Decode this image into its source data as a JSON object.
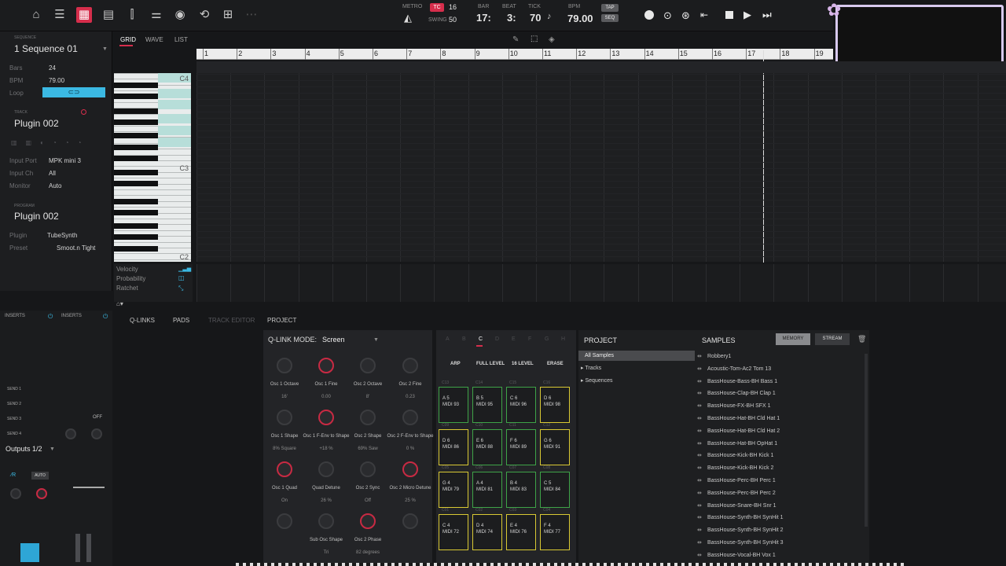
{
  "transport": {
    "metro": "METRO",
    "tc": "TC",
    "tc_val": "16",
    "swing_label": "SWING",
    "swing_val": "50",
    "bar_label": "BAR",
    "bar": "17:",
    "beat_label": "BEAT",
    "beat": "3:",
    "tick_label": "TICK",
    "tick": "70",
    "bpm_label": "BPM",
    "bpm": "79.00",
    "tap": "TAP",
    "seq": "SEQ"
  },
  "sequence": {
    "section": "SEQUENCE",
    "name": "1 Sequence 01",
    "bars_label": "Bars",
    "bars": "24",
    "bpm_label": "BPM",
    "bpm": "79.00",
    "loop_label": "Loop"
  },
  "track": {
    "section": "TRACK",
    "name": "Plugin 002",
    "input_port_label": "Input Port",
    "input_port": "MPK mini 3",
    "input_ch_label": "Input Ch",
    "input_ch": "All",
    "monitor_label": "Monitor",
    "monitor": "Auto"
  },
  "program": {
    "section": "PROGRAM",
    "name": "Plugin 002",
    "plugin_label": "Plugin",
    "plugin": "TubeSynth",
    "preset_label": "Preset",
    "preset": "Smoot.n Tight"
  },
  "view_tabs": [
    "GRID",
    "WAVE",
    "LIST"
  ],
  "ruler": [
    "1",
    "2",
    "3",
    "4",
    "5",
    "6",
    "7",
    "8",
    "9",
    "10",
    "11",
    "12",
    "13",
    "14",
    "15",
    "16",
    "17",
    "18",
    "19"
  ],
  "keys": {
    "c4": "C4",
    "c3": "C3",
    "c2": "C2"
  },
  "lanes": [
    "Velocity",
    "Probability",
    "Ratchet"
  ],
  "mixer": {
    "inserts1": "INSERTS",
    "inserts2": "INSERTS",
    "sends": [
      "SEND 1",
      "SEND 2",
      "SEND 3",
      "SEND 4"
    ],
    "off": "OFF",
    "auto": "AUTO",
    "outputs": "Outputs 1/2"
  },
  "bottom_tabs": {
    "qlinks": "Q-LINKS",
    "pads": "PADS",
    "track_editor": "TRACK EDITOR",
    "project": "PROJECT"
  },
  "qlink": {
    "mode_label": "Q-LINK MODE:",
    "mode": "Screen",
    "knobs": [
      {
        "name": "Osc 1 Octave",
        "value": "16'"
      },
      {
        "name": "Osc 1 Fine",
        "value": "0.00"
      },
      {
        "name": "Osc 2 Octave",
        "value": "8'"
      },
      {
        "name": "Osc 2 Fine",
        "value": "0.23"
      },
      {
        "name": "Osc 1 Shape",
        "value": "8% Square"
      },
      {
        "name": "Osc 1 F-Env to Shape",
        "value": "+18 %"
      },
      {
        "name": "Osc 2 Shape",
        "value": "69% Saw"
      },
      {
        "name": "Osc 2 F-Env to Shape",
        "value": "0 %"
      },
      {
        "name": "Osc 1 Quad",
        "value": "On"
      },
      {
        "name": "Quad Detune",
        "value": "26 %"
      },
      {
        "name": "Osc 2 Sync",
        "value": "Off"
      },
      {
        "name": "Osc 2 Micro Detune",
        "value": "25 %"
      },
      {
        "name": "",
        "value": ""
      },
      {
        "name": "Sub Osc Shape",
        "value": "Tri"
      },
      {
        "name": "Osc 2 Phase",
        "value": "82 degrees"
      },
      {
        "name": "",
        "value": ""
      }
    ]
  },
  "pads": {
    "banks": [
      "A",
      "B",
      "C",
      "D",
      "E",
      "F",
      "G",
      "H"
    ],
    "heads": [
      "ARP",
      "FULL LEVEL",
      "16 LEVEL",
      "ERASE"
    ],
    "grid": [
      {
        "num": "C13",
        "note": "A 5",
        "midi": "MIDI 93"
      },
      {
        "num": "C14",
        "note": "B 5",
        "midi": "MIDI 95"
      },
      {
        "num": "C15",
        "note": "C 6",
        "midi": "MIDI 96"
      },
      {
        "num": "C16",
        "note": "D 6",
        "midi": "MIDI 98"
      },
      {
        "num": "C09",
        "note": "D 6",
        "midi": "MIDI 86"
      },
      {
        "num": "C10",
        "note": "E 6",
        "midi": "MIDI 88"
      },
      {
        "num": "C11",
        "note": "F 6",
        "midi": "MIDI 89"
      },
      {
        "num": "C12",
        "note": "G 6",
        "midi": "MIDI 91"
      },
      {
        "num": "C05",
        "note": "G 4",
        "midi": "MIDI 79"
      },
      {
        "num": "C06",
        "note": "A 4",
        "midi": "MIDI 81"
      },
      {
        "num": "C07",
        "note": "B 4",
        "midi": "MIDI 83"
      },
      {
        "num": "C08",
        "note": "C 5",
        "midi": "MIDI 84"
      },
      {
        "num": "C01",
        "note": "C 4",
        "midi": "MIDI 72"
      },
      {
        "num": "C02",
        "note": "D 4",
        "midi": "MIDI 74"
      },
      {
        "num": "C03",
        "note": "E 4",
        "midi": "MIDI 76"
      },
      {
        "num": "C04",
        "note": "F 4",
        "midi": "MIDI 77"
      }
    ]
  },
  "project": {
    "title": "PROJECT",
    "items": [
      "All Samples",
      "Tracks",
      "Sequences"
    ]
  },
  "samples": {
    "title": "SAMPLES",
    "memory": "MEMORY",
    "stream": "STREAM",
    "list": [
      "Robbery1",
      "Acoustic-Tom-Ac2 Tom 13",
      "BassHouse-Bass-BH Bass 1",
      "BassHouse-Clap-BH Clap 1",
      "BassHouse-FX-BH SFX 1",
      "BassHouse-Hat-BH Cld Hat 1",
      "BassHouse-Hat-BH Cld Hat 2",
      "BassHouse-Hat-BH OpHat 1",
      "BassHouse-Kick-BH Kick 1",
      "BassHouse-Kick-BH Kick 2",
      "BassHouse-Perc-BH Perc 1",
      "BassHouse-Perc-BH Perc 2",
      "BassHouse-Snare-BH Snr 1",
      "BassHouse-Synth-BH SynHit 1",
      "BassHouse-Synth-BH SynHit 2",
      "BassHouse-Synth-BH SynHit 3",
      "BassHouse-Vocal-BH Vox 1"
    ]
  },
  "colors": {
    "accent": "#d62e4c",
    "loop": "#3bb9e3",
    "pad_green": "#3ea347",
    "pad_yellow": "#d9c933"
  }
}
